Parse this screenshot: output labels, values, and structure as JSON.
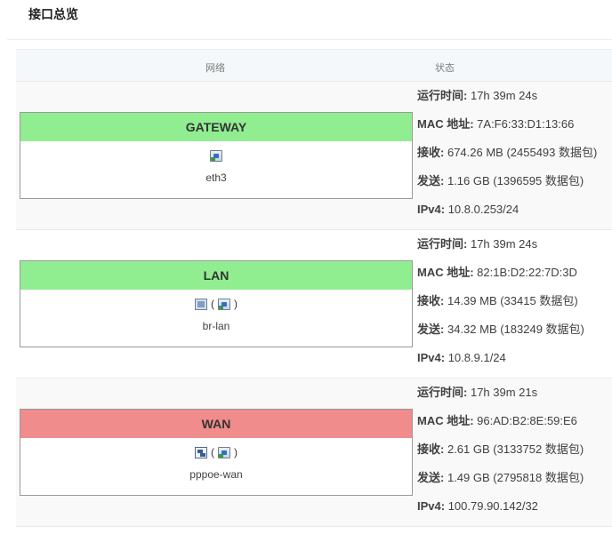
{
  "page_title": "接口总览",
  "table": {
    "col_network": "网络",
    "col_status": "状态"
  },
  "labels": {
    "uptime": "运行时间:",
    "mac": "MAC 地址:",
    "rx": "接收:",
    "tx": "发送:",
    "ipv4": "IPv4:"
  },
  "interfaces": [
    {
      "name": "GATEWAY",
      "header_color": "#90ee90",
      "icons": [
        "ethernet-icon"
      ],
      "icons_text": "",
      "device": "eth3",
      "uptime": "17h 39m 24s",
      "mac": "7A:F6:33:D1:13:66",
      "rx": "674.26 MB (2455493 数据包)",
      "tx": "1.16 GB (1396595 数据包)",
      "ipv4": "10.8.0.253/24"
    },
    {
      "name": "LAN",
      "header_color": "#90ee90",
      "icons": [
        "bridge-icon",
        "ethernet-icon"
      ],
      "icons_text": "",
      "device": "br-lan",
      "uptime": "17h 39m 24s",
      "mac": "82:1B:D2:22:7D:3D",
      "rx": "14.39 MB (33415 数据包)",
      "tx": "34.32 MB (183249 数据包)",
      "ipv4": "10.8.9.1/24"
    },
    {
      "name": "WAN",
      "header_color": "#f08c8c",
      "icons": [
        "pppoe-icon",
        "ethernet-icon"
      ],
      "icons_text": "",
      "device": "pppoe-wan",
      "uptime": "17h 39m 21s",
      "mac": "96:AD:B2:8E:59:E6",
      "rx": "2.61 GB (3133752 数据包)",
      "tx": "1.49 GB (2795818 数据包)",
      "ipv4": "100.79.90.142/32"
    }
  ]
}
